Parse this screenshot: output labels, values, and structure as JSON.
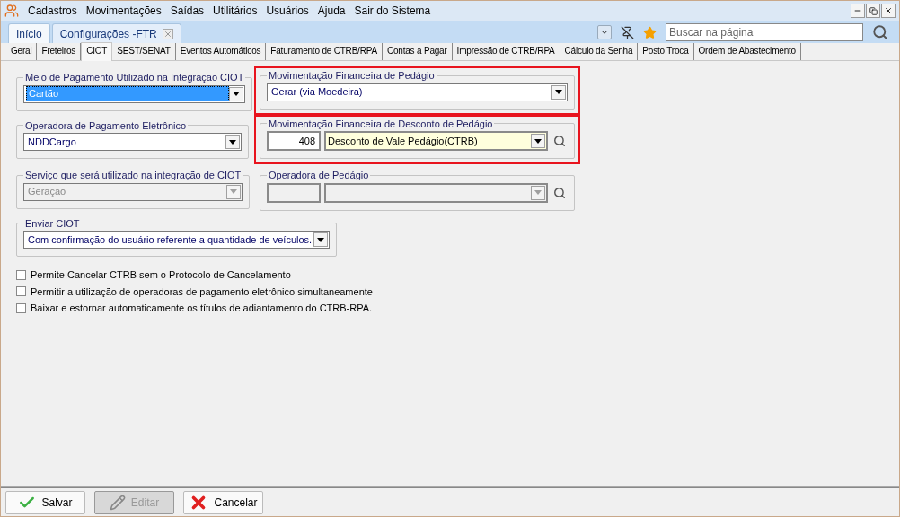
{
  "menu": [
    {
      "label": "Cadastros"
    },
    {
      "label": "Movimentações"
    },
    {
      "label": "Saídas"
    },
    {
      "label": "Utilitários"
    },
    {
      "label": "Usuários"
    },
    {
      "label": "Ajuda"
    },
    {
      "label": "Sair do Sistema"
    }
  ],
  "page_tabs": [
    {
      "label": "Início",
      "selected": false,
      "closable": false
    },
    {
      "label": "Configurações -FTR",
      "selected": true,
      "closable": true
    }
  ],
  "search": {
    "placeholder": "Buscar na página"
  },
  "sub_tabs": [
    {
      "label": "Geral",
      "selected": false
    },
    {
      "label": "Freteiros",
      "selected": false
    },
    {
      "label": "CIOT",
      "selected": true
    },
    {
      "label": "SEST/SENAT",
      "selected": false
    },
    {
      "label": "Eventos Automáticos",
      "selected": false
    },
    {
      "label": "Faturamento de CTRB/RPA",
      "selected": false
    },
    {
      "label": "Contas a Pagar",
      "selected": false
    },
    {
      "label": "Impressão de CTRB/RPA",
      "selected": false
    },
    {
      "label": "Cálculo da Senha",
      "selected": false
    },
    {
      "label": "Posto Troca",
      "selected": false
    },
    {
      "label": "Ordem de Abastecimento",
      "selected": false
    }
  ],
  "groups": [
    {
      "title": "Meio de Pagamento Utilizado na Integração CIOT",
      "highlighted": false,
      "field": {
        "kind": "select",
        "value": "Cartão",
        "selected": true,
        "disabled": false
      }
    },
    {
      "title": "Movimentação Financeira de Pedágio",
      "highlighted": true,
      "field": {
        "kind": "select",
        "value": "Gerar (via Moedeira)",
        "selected": false,
        "disabled": false
      }
    },
    {
      "title": "Operadora de Pagamento Eletrônico",
      "highlighted": false,
      "field": {
        "kind": "select",
        "value": "NDDCargo",
        "selected": false,
        "disabled": false
      }
    },
    {
      "title": "Movimentação Financeira de Desconto de  Pedágio",
      "highlighted": true,
      "field": {
        "kind": "lookup",
        "code": "408",
        "value": "Desconto de Vale Pedágio(CTRB)",
        "disabled": false
      }
    },
    {
      "title": "Serviço que será utilizado na integração de CIOT",
      "highlighted": false,
      "field": {
        "kind": "select",
        "value": "Geração",
        "selected": false,
        "disabled": true
      }
    },
    {
      "title": "Operadora de Pedágio",
      "highlighted": false,
      "field": {
        "kind": "lookup",
        "disabled": true
      }
    },
    {
      "title": "Enviar CIOT",
      "highlighted": false,
      "field": {
        "kind": "select",
        "value": "Com confirmação do usuário referente a quantidade de veículos.",
        "selected": false,
        "disabled": false
      }
    }
  ],
  "checkboxes": [
    {
      "label": "Permite Cancelar CTRB sem o Protocolo de Cancelamento",
      "checked": false
    },
    {
      "label": "Permitir a utilização de operadoras de pagamento eletrônico simultaneamente",
      "checked": false
    },
    {
      "label": "Baixar e estornar automaticamente os títulos de adiantamento do CTRB-RPA.",
      "checked": false
    }
  ],
  "buttons": [
    {
      "label": "Salvar",
      "kind": "save",
      "disabled": false
    },
    {
      "label": "Editar",
      "kind": "edit",
      "disabled": true
    },
    {
      "label": "Cancelar",
      "kind": "cancel",
      "disabled": false
    }
  ]
}
